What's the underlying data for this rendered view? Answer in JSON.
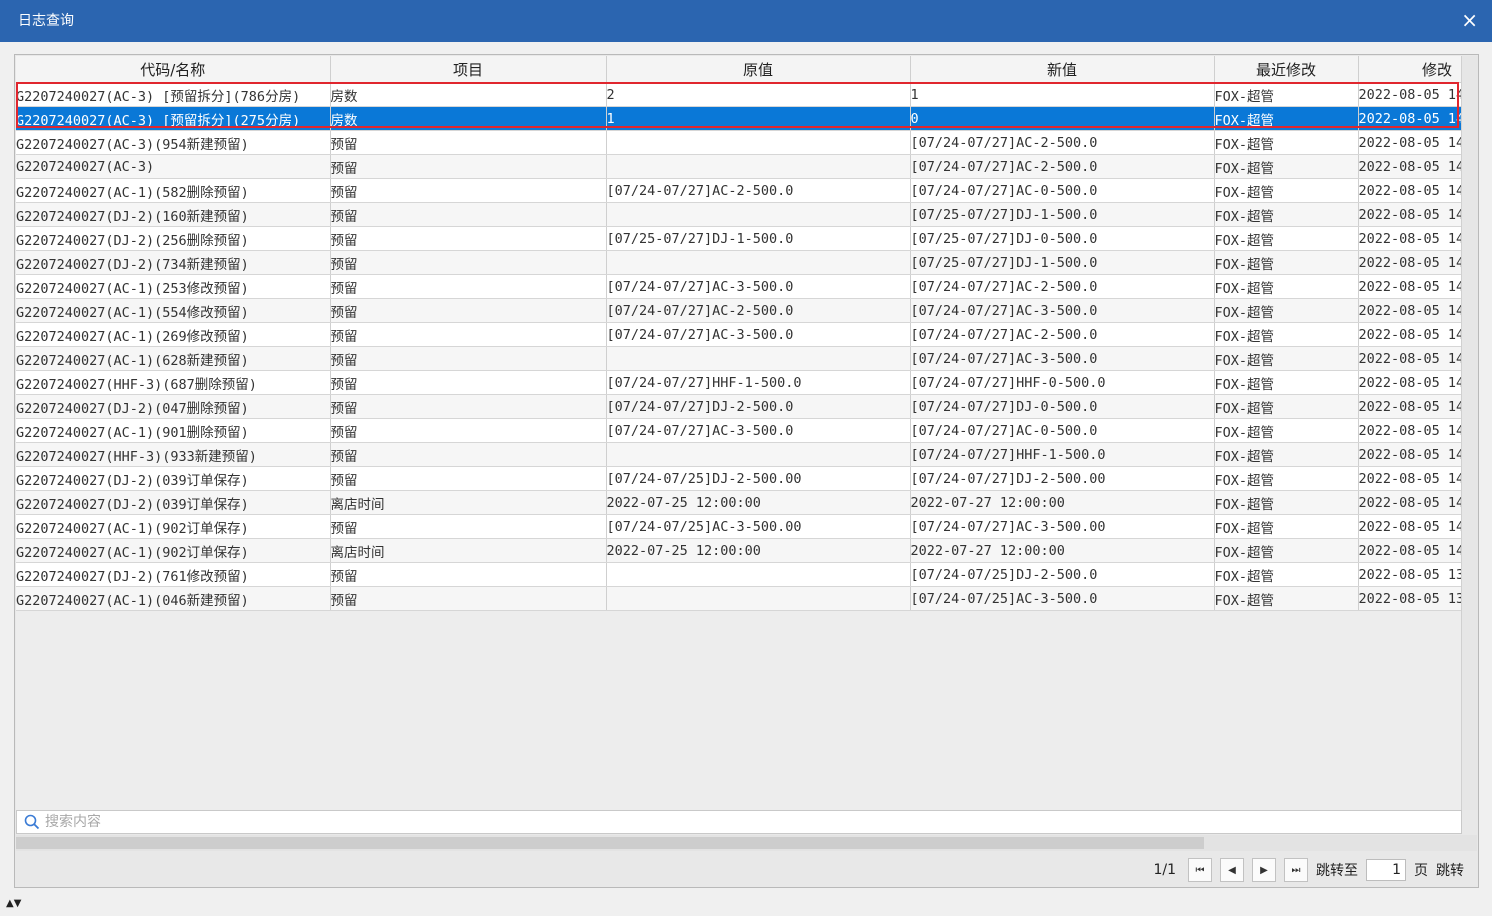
{
  "window": {
    "title": "日志查询",
    "close_glyph": "×"
  },
  "columns": [
    "代码/名称",
    "项目",
    "原值",
    "新值",
    "最近修改",
    "修改"
  ],
  "rows": [
    [
      "G2207240027(AC-3) [预留拆分](786分房)",
      "房数",
      "2",
      "1",
      "FOX-超管",
      "2022-08-05 14"
    ],
    [
      "G2207240027(AC-3) [预留拆分](275分房)",
      "房数",
      "1",
      "0",
      "FOX-超管",
      "2022-08-05 14"
    ],
    [
      "G2207240027(AC-3)(954新建预留)",
      "预留",
      "",
      "[07/24-07/27]AC-2-500.0",
      "FOX-超管",
      "2022-08-05 14"
    ],
    [
      "G2207240027(AC-3)",
      "预留",
      "",
      "[07/24-07/27]AC-2-500.0",
      "FOX-超管",
      "2022-08-05 14"
    ],
    [
      "G2207240027(AC-1)(582删除预留)",
      "预留",
      "[07/24-07/27]AC-2-500.0",
      "[07/24-07/27]AC-0-500.0",
      "FOX-超管",
      "2022-08-05 14"
    ],
    [
      "G2207240027(DJ-2)(160新建预留)",
      "预留",
      "",
      "[07/25-07/27]DJ-1-500.0",
      "FOX-超管",
      "2022-08-05 14"
    ],
    [
      "G2207240027(DJ-2)(256删除预留)",
      "预留",
      "[07/25-07/27]DJ-1-500.0",
      "[07/25-07/27]DJ-0-500.0",
      "FOX-超管",
      "2022-08-05 14"
    ],
    [
      "G2207240027(DJ-2)(734新建预留)",
      "预留",
      "",
      "[07/25-07/27]DJ-1-500.0",
      "FOX-超管",
      "2022-08-05 14"
    ],
    [
      "G2207240027(AC-1)(253修改预留)",
      "预留",
      "[07/24-07/27]AC-3-500.0",
      "[07/24-07/27]AC-2-500.0",
      "FOX-超管",
      "2022-08-05 14"
    ],
    [
      "G2207240027(AC-1)(554修改预留)",
      "预留",
      "[07/24-07/27]AC-2-500.0",
      "[07/24-07/27]AC-3-500.0",
      "FOX-超管",
      "2022-08-05 14"
    ],
    [
      "G2207240027(AC-1)(269修改预留)",
      "预留",
      "[07/24-07/27]AC-3-500.0",
      "[07/24-07/27]AC-2-500.0",
      "FOX-超管",
      "2022-08-05 14"
    ],
    [
      "G2207240027(AC-1)(628新建预留)",
      "预留",
      "",
      "[07/24-07/27]AC-3-500.0",
      "FOX-超管",
      "2022-08-05 14"
    ],
    [
      "G2207240027(HHF-3)(687删除预留)",
      "预留",
      "[07/24-07/27]HHF-1-500.0",
      "[07/24-07/27]HHF-0-500.0",
      "FOX-超管",
      "2022-08-05 14"
    ],
    [
      "G2207240027(DJ-2)(047删除预留)",
      "预留",
      "[07/24-07/27]DJ-2-500.0",
      "[07/24-07/27]DJ-0-500.0",
      "FOX-超管",
      "2022-08-05 14"
    ],
    [
      "G2207240027(AC-1)(901删除预留)",
      "预留",
      "[07/24-07/27]AC-3-500.0",
      "[07/24-07/27]AC-0-500.0",
      "FOX-超管",
      "2022-08-05 14"
    ],
    [
      "G2207240027(HHF-3)(933新建预留)",
      "预留",
      "",
      "[07/24-07/27]HHF-1-500.0",
      "FOX-超管",
      "2022-08-05 14"
    ],
    [
      "G2207240027(DJ-2)(039订单保存)",
      "预留",
      "[07/24-07/25]DJ-2-500.00",
      "[07/24-07/27]DJ-2-500.00",
      "FOX-超管",
      "2022-08-05 14"
    ],
    [
      "G2207240027(DJ-2)(039订单保存)",
      "离店时间",
      "2022-07-25 12:00:00",
      "2022-07-27 12:00:00",
      "FOX-超管",
      "2022-08-05 14"
    ],
    [
      "G2207240027(AC-1)(902订单保存)",
      "预留",
      "[07/24-07/25]AC-3-500.00",
      "[07/24-07/27]AC-3-500.00",
      "FOX-超管",
      "2022-08-05 14"
    ],
    [
      "G2207240027(AC-1)(902订单保存)",
      "离店时间",
      "2022-07-25 12:00:00",
      "2022-07-27 12:00:00",
      "FOX-超管",
      "2022-08-05 14"
    ],
    [
      "G2207240027(DJ-2)(761修改预留)",
      "预留",
      "",
      "[07/24-07/25]DJ-2-500.0",
      "FOX-超管",
      "2022-08-05 13"
    ],
    [
      "G2207240027(AC-1)(046新建预留)",
      "预留",
      "",
      "[07/24-07/25]AC-3-500.0",
      "FOX-超管",
      "2022-08-05 13"
    ]
  ],
  "selected_row": 1,
  "search": {
    "placeholder": "搜索内容",
    "icon": "search-icon"
  },
  "pager": {
    "page_info": "1/1",
    "first_glyph": "⏮",
    "prev_glyph": "◀",
    "next_glyph": "▶",
    "last_glyph": "⏭",
    "goto_label": "跳转至",
    "page_value": "1",
    "page_unit": "页",
    "go_button": "跳转"
  },
  "bottom_toggle": "▲▼",
  "colors": {
    "titlebar": "#2b65b0",
    "selected_row": "#0a78d7",
    "highlight_box": "#e0262e"
  }
}
